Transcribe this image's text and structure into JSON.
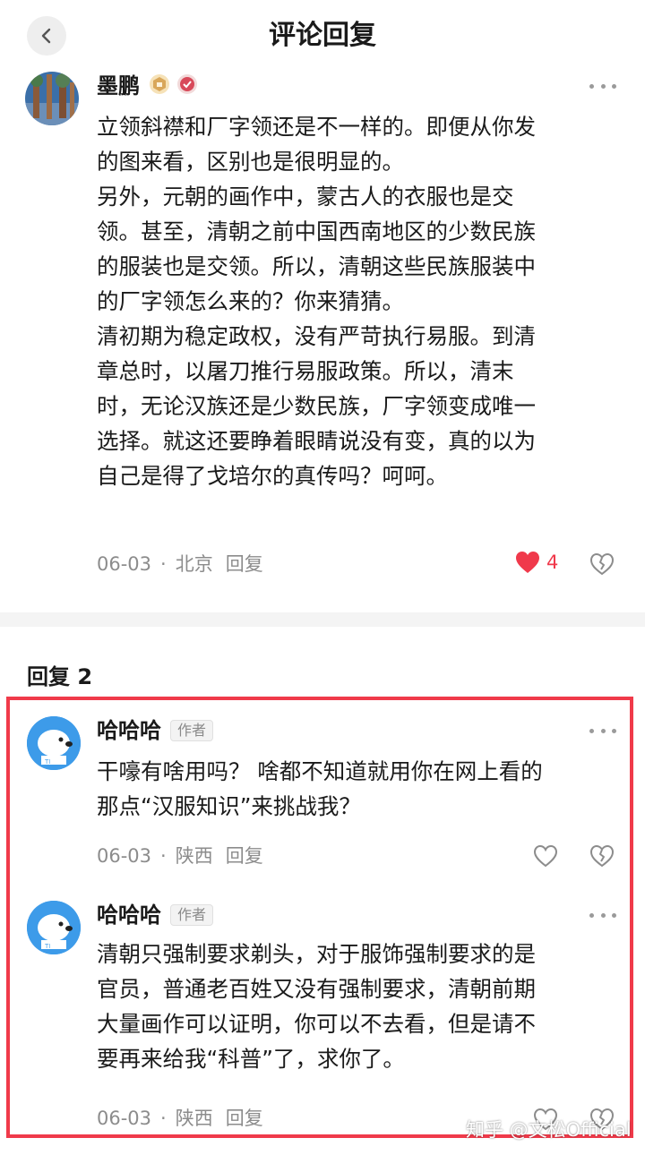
{
  "header": {
    "title": "评论回复"
  },
  "main_comment": {
    "username": "墨鹏",
    "text": "立领斜襟和厂字领还是不一样的。即便从你发\n的图来看，区别也是很明显的。\n另外，元朝的画作中，蒙古人的衣服也是交\n领。甚至，清朝之前中国西南地区的少数民族\n的服装也是交领。所以，清朝这些民族服装中\n的厂字领怎么来的？你来猜猜。\n清初期为稳定政权，没有严苛执行易服。到清\n章总时，以屠刀推行易服政策。所以，清末\n时，无论汉族还是少数民族，厂字领变成唯一\n选择。就这还要睁着眼睛说没有变，真的以为\n自己是得了戈培尔的真传吗？呵呵。",
    "date": "06-03",
    "location": "北京",
    "reply_label": "回复",
    "like_count": "4",
    "liked": true
  },
  "replies": {
    "header": "回复 2",
    "items": [
      {
        "username": "哈哈哈",
        "tag": "作者",
        "text": "干嚎有啥用吗？ 啥都不知道就用你在网上看的\n那点“汉服知识”来挑战我？",
        "date": "06-03",
        "location": "陕西",
        "reply_label": "回复"
      },
      {
        "username": "哈哈哈",
        "tag": "作者",
        "text": "清朝只强制要求剃头，对于服饰强制要求的是\n官员，普通老百姓又没有强制要求，清朝前期\n大量画作可以证明，你可以不去看，但是请不\n要再来给我“科普”了，求你了。",
        "date": "06-03",
        "location": "陕西",
        "reply_label": "回复"
      }
    ]
  },
  "watermark": "知乎 @文松Official",
  "colors": {
    "accent_red": "#f03a4a",
    "meta_gray": "#8c8c8c",
    "badge_gold": "#d9a75a"
  }
}
